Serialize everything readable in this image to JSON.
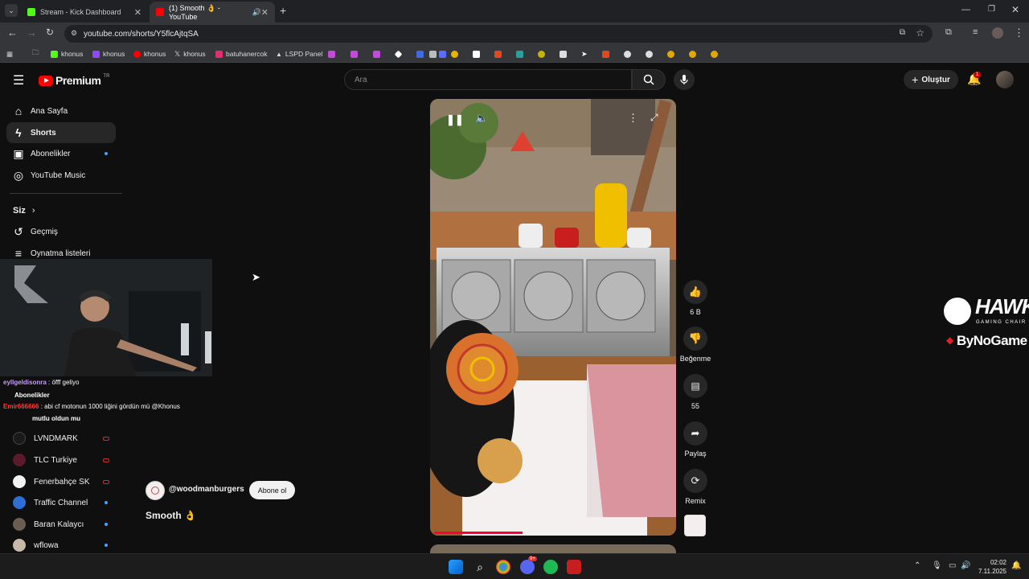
{
  "browser": {
    "tabs": [
      {
        "title": "Stream - Kick Dashboard",
        "icon": "kick-icon",
        "color": "#53fc18",
        "active": false
      },
      {
        "title": "(1) Smooth 👌 - YouTube",
        "icon": "youtube-icon",
        "color": "#ff0000",
        "active": true
      }
    ],
    "url": "youtube.com/shorts/Y5flcAjtqSA",
    "bookmarks": [
      {
        "label": "khonus",
        "icon": "kick-icon",
        "color": "#53fc18"
      },
      {
        "label": "khonus",
        "icon": "twitch-icon",
        "color": "#9146ff"
      },
      {
        "label": "khonus",
        "icon": "youtube-icon",
        "color": "#ff0000"
      },
      {
        "label": "khonus",
        "icon": "x-icon",
        "color": "#ffffff"
      },
      {
        "label": "batuhanercok",
        "icon": "instagram-icon",
        "color": "#e1306c"
      },
      {
        "label": "LSPD Panel",
        "icon": "lspd-icon",
        "color": "#dddddd"
      }
    ]
  },
  "youtube": {
    "logo_text": "Premium",
    "logo_region": "TR",
    "search_placeholder": "Ara",
    "create_label": "Oluştur",
    "notification_count": "1",
    "sidebar": {
      "main": [
        {
          "label": "Ana Sayfa",
          "icon": "home-icon"
        },
        {
          "label": "Shorts",
          "icon": "shorts-icon",
          "active": true
        },
        {
          "label": "Abonelikler",
          "icon": "subscriptions-icon",
          "dot": true
        },
        {
          "label": "YouTube Music",
          "icon": "youtube-music-icon"
        }
      ],
      "you_header": "Siz",
      "you": [
        {
          "label": "Geçmiş",
          "icon": "history-icon"
        },
        {
          "label": "Oynatma listeleri",
          "icon": "playlist-icon"
        }
      ],
      "subscriptions": [
        {
          "label": "LVNDMARK",
          "badge": "live"
        },
        {
          "label": "TLC Turkiye",
          "badge": "live"
        },
        {
          "label": "Fenerbahçe SK",
          "badge": "live"
        },
        {
          "label": "Traffic Channel",
          "badge": "dot"
        },
        {
          "label": "Baran Kalaycı",
          "badge": "dot"
        },
        {
          "label": "wflowa",
          "badge": "dot"
        }
      ]
    },
    "short": {
      "channel": "@woodmanburgers",
      "subscribe_label": "Abone ol",
      "title": "Smooth 👌",
      "likes": "6 B",
      "dislike_label": "Beğenme",
      "comments": "55",
      "share_label": "Paylaş",
      "remix_label": "Remix"
    }
  },
  "overlay": {
    "chat": [
      {
        "user": "eyllgeldisonra",
        "msg": ": öfff geliyo",
        "color": "#c89bff"
      },
      {
        "user": "",
        "msg": "Abonelikler",
        "color": "#ffffff"
      },
      {
        "user": "Emir666666",
        "msg": ": abi cf motonun 1000 liğini gördün mü @Khonus",
        "color": "#ff3b3b"
      },
      {
        "user": "",
        "msg": "mutlu oldun mu",
        "color": "#ffffff"
      }
    ],
    "sponsor_line1": "HAWK",
    "sponsor_sub": "GAMING CHAIR",
    "sponsor_line2": "ByNoGame"
  },
  "taskbar": {
    "time": "02:02",
    "date": "7.11.2025",
    "discord_badge": "9+"
  }
}
